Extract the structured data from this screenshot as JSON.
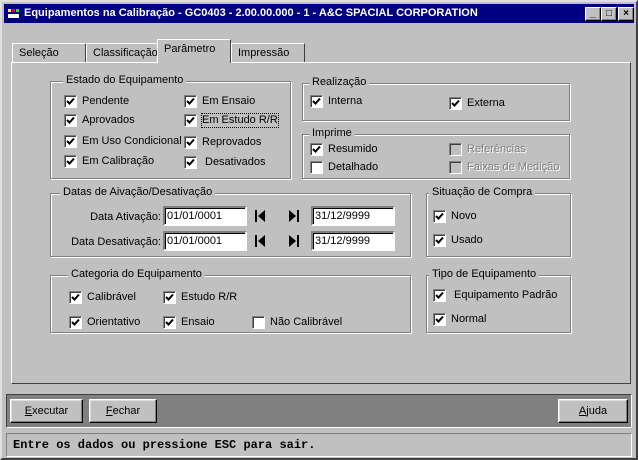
{
  "window": {
    "title": "Equipamentos na Calibração - GC0403 - 2.00.00.000 - 1 - A&C SPACIAL CORPORATION",
    "minimize": "_",
    "maximize": "□",
    "close": "×"
  },
  "tabs": [
    {
      "label": "Seleção"
    },
    {
      "label": "Classificação"
    },
    {
      "label": "Parâmetro"
    },
    {
      "label": "Impressão"
    }
  ],
  "estado": {
    "title": "Estado do Equipamento",
    "items": [
      {
        "label": "Pendente",
        "checked": true
      },
      {
        "label": "Em Ensaio",
        "checked": true
      },
      {
        "label": "Aprovados",
        "checked": true
      },
      {
        "label": "Em Estudo R/R",
        "checked": true
      },
      {
        "label": "Em Uso Condicional",
        "checked": true
      },
      {
        "label": "Reprovados",
        "checked": true
      },
      {
        "label": "Em Calibração",
        "checked": true
      },
      {
        "label": "Desativados",
        "checked": true
      }
    ]
  },
  "realizacao": {
    "title": "Realização",
    "items": [
      {
        "label": "Interna",
        "checked": true
      },
      {
        "label": "Externa",
        "checked": true
      }
    ]
  },
  "imprime": {
    "title": "Imprime",
    "items": [
      {
        "label": "Resumido",
        "checked": true
      },
      {
        "label": "Detalhado",
        "checked": false
      },
      {
        "label": "Referências",
        "checked": false,
        "disabled": true
      },
      {
        "label": "Faixas de Medição",
        "checked": false,
        "disabled": true
      }
    ]
  },
  "datas": {
    "title": "Datas de Aivação/Desativação",
    "ativacao_label": "Data Ativação:",
    "ativacao_from": "01/01/0001",
    "ativacao_to": "31/12/9999",
    "desativacao_label": "Data Desativação:",
    "desativacao_from": "01/01/0001",
    "desativacao_to": "31/12/9999"
  },
  "situacao": {
    "title": "Situação de Compra",
    "items": [
      {
        "label": "Novo",
        "checked": true
      },
      {
        "label": "Usado",
        "checked": true
      }
    ]
  },
  "categoria": {
    "title": "Categoria do Equipamento",
    "items": [
      {
        "label": "Calibrável",
        "checked": true
      },
      {
        "label": "Estudo R/R",
        "checked": true
      },
      {
        "label": "Orientativo",
        "checked": true
      },
      {
        "label": "Ensaio",
        "checked": true
      },
      {
        "label": "Não Calibrável",
        "checked": false
      }
    ]
  },
  "tipo": {
    "title": "Tipo de Equipamento",
    "items": [
      {
        "label": "Equipamento Padrão",
        "checked": true
      },
      {
        "label": "Normal",
        "checked": true
      }
    ]
  },
  "buttons": {
    "executar_u": "E",
    "executar_rest": "xecutar",
    "fechar_u": "F",
    "fechar_rest": "echar",
    "ajuda_u": "A",
    "ajuda_rest": "juda"
  },
  "status": "Entre os dados ou pressione ESC para sair."
}
